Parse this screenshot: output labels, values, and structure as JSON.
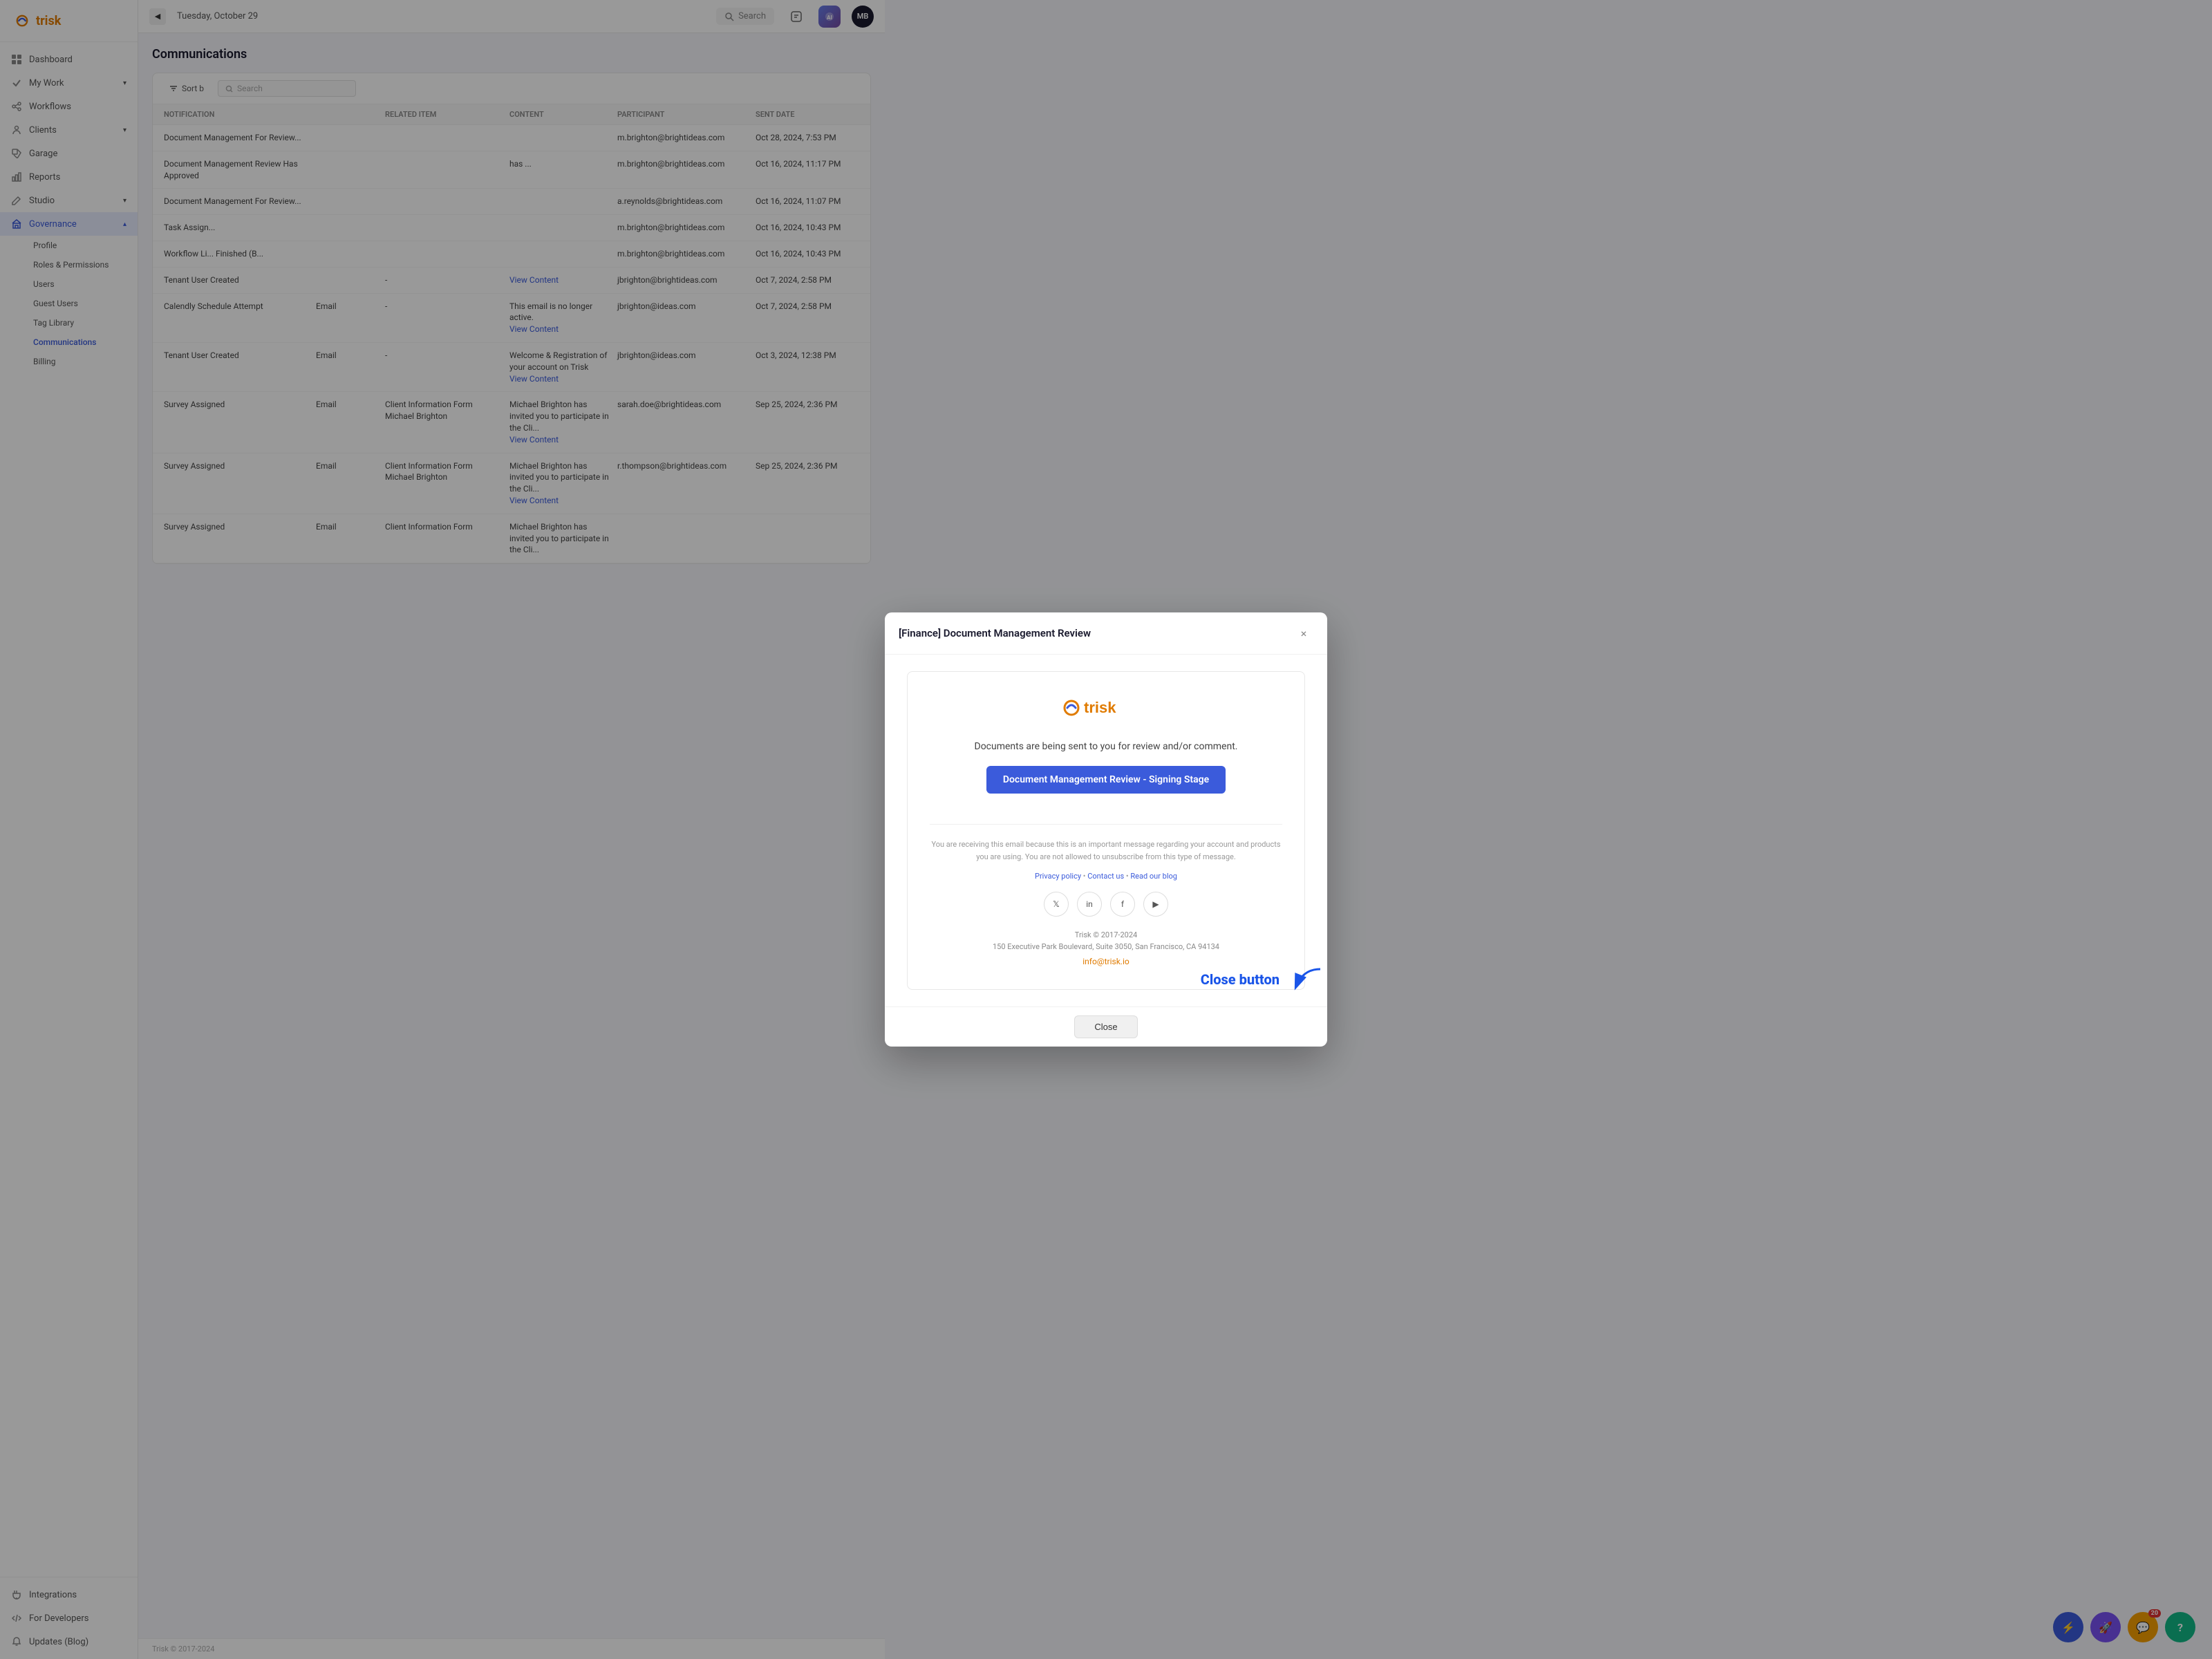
{
  "app": {
    "logo_text": "trisk",
    "header": {
      "date": "Tuesday, October 29",
      "search_label": "Search",
      "avatar_initials": "MB",
      "toggle_icon": "◀"
    }
  },
  "sidebar": {
    "nav_items": [
      {
        "id": "dashboard",
        "label": "Dashboard",
        "icon": "grid"
      },
      {
        "id": "my-work",
        "label": "My Work",
        "icon": "checkmark",
        "has_chevron": true
      },
      {
        "id": "workflows",
        "label": "Workflows",
        "icon": "flow"
      },
      {
        "id": "clients",
        "label": "Clients",
        "icon": "person",
        "has_chevron": true
      },
      {
        "id": "garage",
        "label": "Garage",
        "icon": "tag"
      },
      {
        "id": "reports",
        "label": "Reports",
        "icon": "chart"
      },
      {
        "id": "studio",
        "label": "Studio",
        "icon": "edit",
        "has_chevron": true
      },
      {
        "id": "governance",
        "label": "Governance",
        "icon": "building",
        "active": true,
        "expanded": true
      }
    ],
    "governance_subitems": [
      {
        "id": "profile",
        "label": "Profile"
      },
      {
        "id": "roles",
        "label": "Roles & Permissions"
      },
      {
        "id": "users",
        "label": "Users"
      },
      {
        "id": "guest-users",
        "label": "Guest Users"
      },
      {
        "id": "tag-library",
        "label": "Tag Library"
      },
      {
        "id": "communications",
        "label": "Communications",
        "active": true
      },
      {
        "id": "billing",
        "label": "Billing"
      }
    ],
    "bottom_items": [
      {
        "id": "integrations",
        "label": "Integrations",
        "icon": "plug"
      },
      {
        "id": "for-developers",
        "label": "For Developers",
        "icon": "code"
      },
      {
        "id": "updates",
        "label": "Updates (Blog)",
        "icon": "bell"
      }
    ]
  },
  "page": {
    "title": "Communications",
    "toolbar": {
      "sort_label": "Sort b",
      "search_placeholder": "Search"
    },
    "table": {
      "columns": [
        "Notification",
        "",
        "Related Item",
        "Content",
        "Participant",
        "Sent Date"
      ],
      "rows": [
        {
          "notification": "Document Management For Review...",
          "type": "",
          "related": "",
          "content": "",
          "participant": "m.brighton@brightideas.com",
          "sent_date": "Oct 28, 2024, 7:53 PM"
        },
        {
          "notification": "Document Management Review Has Approved",
          "type": "",
          "related": "",
          "content": "has ...",
          "participant": "m.brighton@brightideas.com",
          "sent_date": "Oct 16, 2024, 11:17 PM"
        },
        {
          "notification": "Document Management For Review...",
          "type": "",
          "related": "",
          "content": "",
          "participant": "a.reynolds@brightideas.com",
          "sent_date": "Oct 16, 2024, 11:07 PM"
        },
        {
          "notification": "Task Assign...",
          "type": "",
          "related": "",
          "content": "",
          "participant": "m.brighton@brightideas.com",
          "sent_date": "Oct 16, 2024, 10:43 PM"
        },
        {
          "notification": "Workflow Li... Finished (B...",
          "type": "",
          "related": "",
          "content": "",
          "participant": "m.brighton@brightideas.com",
          "sent_date": "Oct 16, 2024, 10:43 PM"
        },
        {
          "notification": "Tenant User Created",
          "type": "",
          "related": "-",
          "content": "View Content",
          "participant": "jbrighton@brightideas.com",
          "sent_date": "Oct 7, 2024, 2:58 PM"
        },
        {
          "notification": "Calendly Schedule Attempt",
          "type": "Email",
          "related": "-",
          "content": "This email is no longer active.\nView Content",
          "participant": "jbrighton@ideas.com",
          "sent_date": "Oct 7, 2024, 2:58 PM"
        },
        {
          "notification": "Tenant User Created",
          "type": "Email",
          "related": "-",
          "content": "Welcome & Registration of your account on Trisk\nView Content",
          "participant": "jbrighton@ideas.com",
          "sent_date": "Oct 3, 2024, 12:38 PM"
        },
        {
          "notification": "Survey Assigned",
          "type": "Email",
          "related": "Client Information Form\nMichael Brighton",
          "content": "Michael Brighton has invited you to participate in the Cli...\nView Content",
          "participant": "sarah.doe@brightideas.com",
          "sent_date": "Sep 25, 2024, 2:36 PM"
        },
        {
          "notification": "Survey Assigned",
          "type": "Email",
          "related": "Client Information Form\nMichael Brighton",
          "content": "Michael Brighton has invited you to participate in the Cli...\nView Content",
          "participant": "r.thompson@brightideas.com",
          "sent_date": "Sep 25, 2024, 2:36 PM"
        },
        {
          "notification": "Survey Assigned",
          "type": "Email",
          "related": "Client Information Form",
          "content": "Michael Brighton has invited you to participate in the Cli...",
          "participant": "",
          "sent_date": ""
        }
      ]
    },
    "footer": "Trisk © 2017-2024"
  },
  "modal": {
    "title": "[Finance] Document Management Review",
    "close_label": "×",
    "email": {
      "message": "Documents are being sent to you for review and/or comment.",
      "cta_label": "Document Management Review - Signing Stage",
      "footer_text": "You are receiving this email because this is an important message regarding your account and products you are using. You are not allowed to unsubscribe from this type of message.",
      "privacy_label": "Privacy policy",
      "contact_label": "Contact us",
      "blog_label": "Read our blog",
      "social_icons": [
        "𝕏",
        "in",
        "f",
        "▶"
      ],
      "company_name": "Trisk © 2017-2024",
      "address": "150 Executive Park Boulevard, Suite 3050, San Francisco, CA 94134",
      "email_link": "info@trisk.io"
    },
    "close_button_label": "Close",
    "annotation": "Close button"
  },
  "fab_buttons": [
    {
      "id": "lightning",
      "label": "⚡",
      "color": "#3b5bdb"
    },
    {
      "id": "rocket",
      "label": "🚀",
      "color": "#7950f2"
    },
    {
      "id": "chat",
      "label": "💬",
      "color": "#f59f00",
      "badge": "20"
    },
    {
      "id": "help",
      "label": "?",
      "color": "#12b886"
    }
  ]
}
